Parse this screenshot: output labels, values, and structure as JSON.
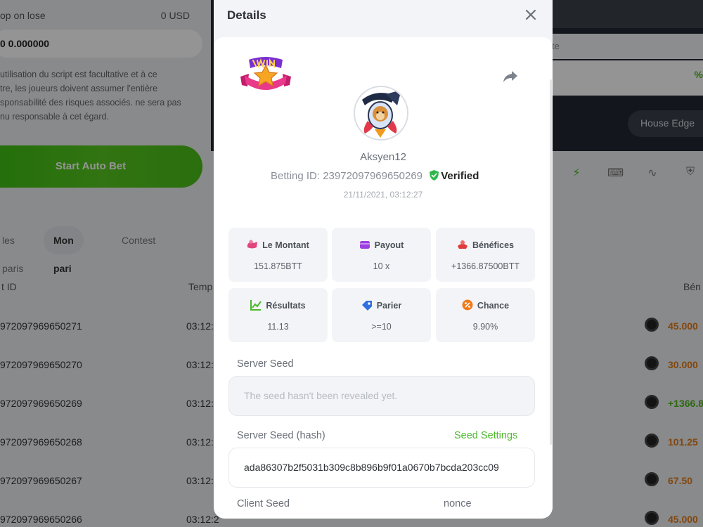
{
  "background": {
    "stop_on_lose_label": "op on lose",
    "stop_on_lose_value": "0 USD",
    "stop_on_lose_amount": "0 0.000000",
    "disclaimer_lines": [
      "utilisation du script est facultative et à ce",
      "tre, les joueurs doivent assumer l'entière",
      "sponsabilité des risques associés. ne sera pas",
      "nu responsable à cet égard."
    ],
    "auto_bet_label": "Start Auto Bet",
    "right_input_text": "te",
    "right_input_pct": "%",
    "house_edge_label": "House Edge",
    "tabs": [
      "les paris",
      "Mon pari",
      "Contest"
    ],
    "col_id": "t ID",
    "col_time": "Temp",
    "col_profit": "Bén",
    "rows": [
      {
        "id": "972097969650271",
        "time": "03:12:",
        "profit": "45.000",
        "color": "#e07b18"
      },
      {
        "id": "972097969650270",
        "time": "03:12:",
        "profit": "30.000",
        "color": "#e07b18"
      },
      {
        "id": "972097969650269",
        "time": "03:12:",
        "profit": "+1366.8",
        "color": "#4cb51a"
      },
      {
        "id": "972097969650268",
        "time": "03:12:",
        "profit": "101.25",
        "color": "#e07b18"
      },
      {
        "id": "972097969650267",
        "time": "03:12:",
        "profit": "67.50",
        "color": "#e07b18"
      },
      {
        "id": "972097969650266",
        "time": "03:12:2",
        "profit": "45.000",
        "color": "#e07b18"
      }
    ]
  },
  "modal": {
    "title": "Details",
    "username": "Aksyen12",
    "betting_id_label": "Betting ID: 23972097969650269",
    "verified_label": "Verified",
    "datetime": "21/11/2021, 03:12:27",
    "stats": [
      {
        "label": "Le Montant",
        "value": "151.875BTT",
        "icon": "money-icon",
        "color": "#e0457b"
      },
      {
        "label": "Payout",
        "value": "10 x",
        "icon": "wallet-icon",
        "color": "#9b3fe0"
      },
      {
        "label": "Bénéfices",
        "value": "+1366.87500BTT",
        "icon": "profit-icon",
        "color": "#e03a3a"
      },
      {
        "label": "Résultats",
        "value": "11.13",
        "icon": "chart-icon",
        "color": "#4cb82c"
      },
      {
        "label": "Parier",
        "value": ">=10",
        "icon": "tag-icon",
        "color": "#2f6fe0"
      },
      {
        "label": "Chance",
        "value": "9.90%",
        "icon": "percent-icon",
        "color": "#f07a1a"
      }
    ],
    "server_seed_label": "Server Seed",
    "server_seed_placeholder": "The seed hasn't been revealed yet.",
    "server_seed_hash_label": "Server Seed (hash)",
    "seed_settings_label": "Seed Settings",
    "server_seed_hash": "ada86307b2f5031b309c8b896b9f01a0670b7bcda203cc09",
    "client_seed_label": "Client Seed",
    "nonce_label": "nonce"
  }
}
